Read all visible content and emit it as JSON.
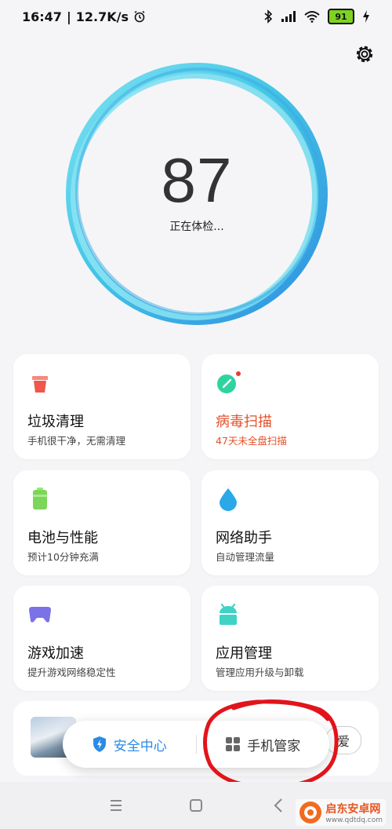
{
  "status": {
    "time": "16:47",
    "net_speed": "12.7K/s",
    "battery": "91"
  },
  "health": {
    "score": "87",
    "status_text": "正在体检..."
  },
  "cards": [
    {
      "title": "垃圾清理",
      "subtitle": "手机很干净，无需清理"
    },
    {
      "title": "病毒扫描",
      "subtitle": "47天未全盘扫描"
    },
    {
      "title": "电池与性能",
      "subtitle": "预计10分钟充满"
    },
    {
      "title": "网络助手",
      "subtitle": "自动管理流量"
    },
    {
      "title": "游戏加速",
      "subtitle": "提升游戏网络稳定性"
    },
    {
      "title": "应用管理",
      "subtitle": "管理应用升级与卸载"
    }
  ],
  "promo": {
    "button_label": "爱"
  },
  "floating_tabs": {
    "security_center": "安全中心",
    "phone_manager": "手机管家"
  },
  "watermark": {
    "brand": "启东安卓网",
    "url": "www.qdtdq.com"
  },
  "colors": {
    "accent_blue": "#2a8be6",
    "warning_red": "#e4522b",
    "annotation_red": "#e2141b"
  },
  "icons": {
    "settings": "gear-icon",
    "trash": "trash-icon",
    "virus": "virus-scan-icon",
    "battery": "battery-icon",
    "network": "water-drop-icon",
    "game": "gamepad-icon",
    "apps": "android-icon"
  }
}
